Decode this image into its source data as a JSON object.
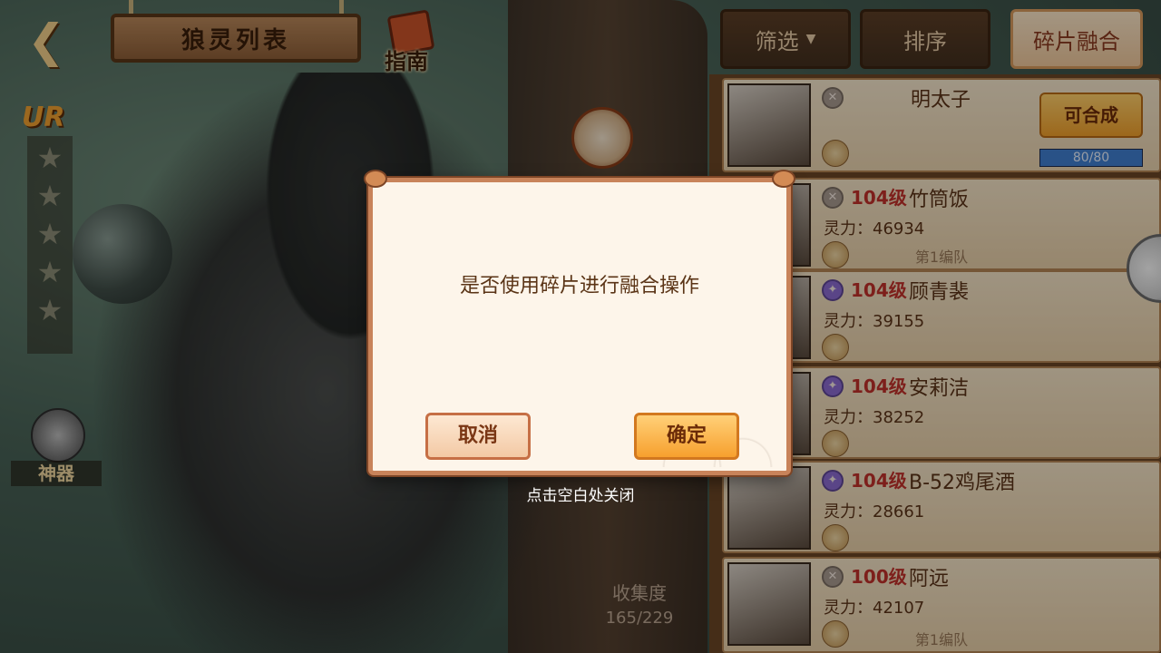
{
  "header": {
    "back_icon": "back-arrow-icon",
    "title": "狼灵列表",
    "guide_label": "指南",
    "rarity": "UR",
    "artifact_label": "神器"
  },
  "collection": {
    "label": "收集度",
    "value": "165/229"
  },
  "toolbar": {
    "filter_label": "筛选",
    "sort_label": "排序",
    "fragment_fusion_label": "碎片融合"
  },
  "top_card": {
    "name": "明太子",
    "compose_label": "可合成",
    "progress_text": "80/80",
    "progress": 1.0
  },
  "cards": [
    {
      "level": "104级",
      "name": "竹筒饭",
      "power": "灵力：46934",
      "team": "第1编队"
    },
    {
      "level": "104级",
      "name": "顾青裴",
      "power": "灵力：39155",
      "team": ""
    },
    {
      "level": "104级",
      "name": "安莉洁",
      "power": "灵力：38252",
      "team": ""
    },
    {
      "level": "104级",
      "name": "B-52鸡尾酒",
      "power": "灵力：28661",
      "team": ""
    },
    {
      "level": "100级",
      "name": "阿远",
      "power": "灵力：42107",
      "team": "第1编队"
    }
  ],
  "modal": {
    "message": "是否使用碎片进行融合操作",
    "cancel_label": "取消",
    "confirm_label": "确定",
    "close_hint": "点击空白处关闭"
  },
  "colors": {
    "accent": "#f7a02e",
    "panel_brown": "#6a4626",
    "level_red": "#c0302a"
  }
}
